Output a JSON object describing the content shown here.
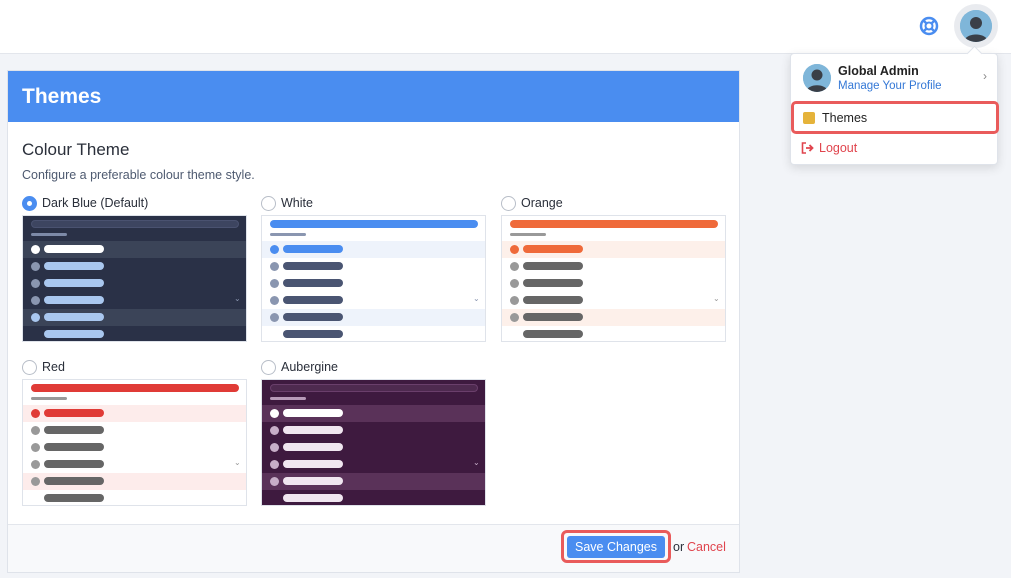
{
  "page": {
    "title": "Themes"
  },
  "section": {
    "title": "Colour Theme",
    "description": "Configure a preferable colour theme style."
  },
  "themes": [
    {
      "label": "Dark Blue (Default)",
      "selected": true
    },
    {
      "label": "White",
      "selected": false
    },
    {
      "label": "Orange",
      "selected": false
    },
    {
      "label": "Red",
      "selected": false
    },
    {
      "label": "Aubergine",
      "selected": false
    }
  ],
  "footer": {
    "save_label": "Save Changes",
    "or_text": "or",
    "cancel_label": "Cancel"
  },
  "user_menu": {
    "name": "Global Admin",
    "manage_label": "Manage Your Profile",
    "themes_label": "Themes",
    "logout_label": "Logout"
  },
  "icons": {
    "help": "lifebuoy-icon",
    "avatar": "user-avatar",
    "themes": "palette-icon",
    "logout": "sign-out-icon"
  },
  "colors": {
    "accent": "#4a8df0",
    "danger": "#e0444d",
    "highlight": "#e95b5b",
    "dark_blue": "#2a3147",
    "orange": "#ef6a3a",
    "red": "#e03b36",
    "aubergine": "#3e1a3f"
  }
}
